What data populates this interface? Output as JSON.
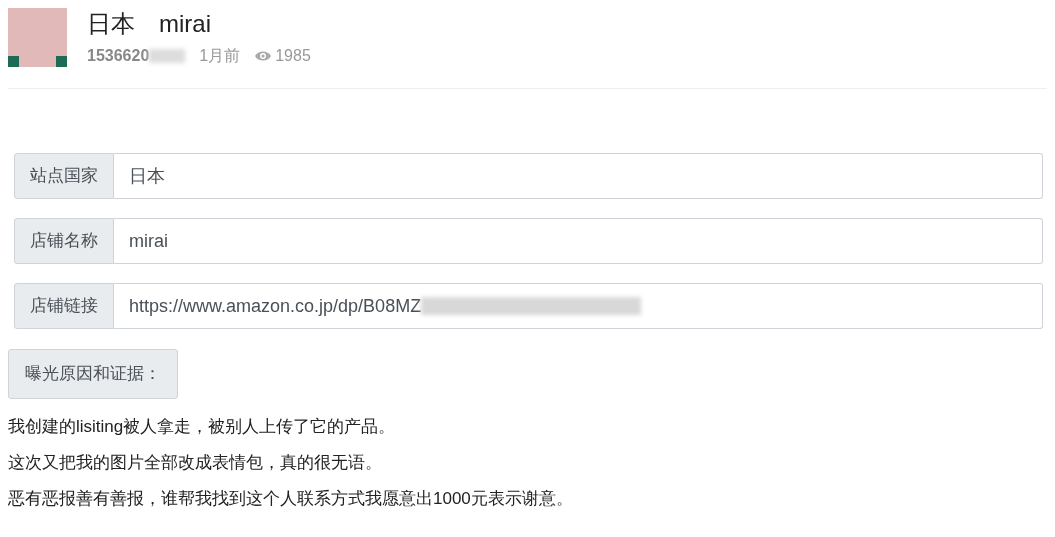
{
  "post": {
    "title": "日本　mirai",
    "author": "1536620",
    "time": "1月前",
    "views": "1985"
  },
  "fields": [
    {
      "label": "站点国家",
      "value": "日本",
      "redacted": false
    },
    {
      "label": "店铺名称",
      "value": "mirai",
      "redacted": false
    },
    {
      "label": "店铺链接",
      "value": "https://www.amazon.co.jp/dp/B08MZ",
      "redacted": true
    }
  ],
  "reason_label": "曝光原因和证据：",
  "paragraphs": [
    "我创建的lisiting被人拿走，被别人上传了它的产品。",
    "这次又把我的图片全部改成表情包，真的很无语。",
    "恶有恶报善有善报，谁帮我找到这个人联系方式我愿意出1000元表示谢意。"
  ]
}
